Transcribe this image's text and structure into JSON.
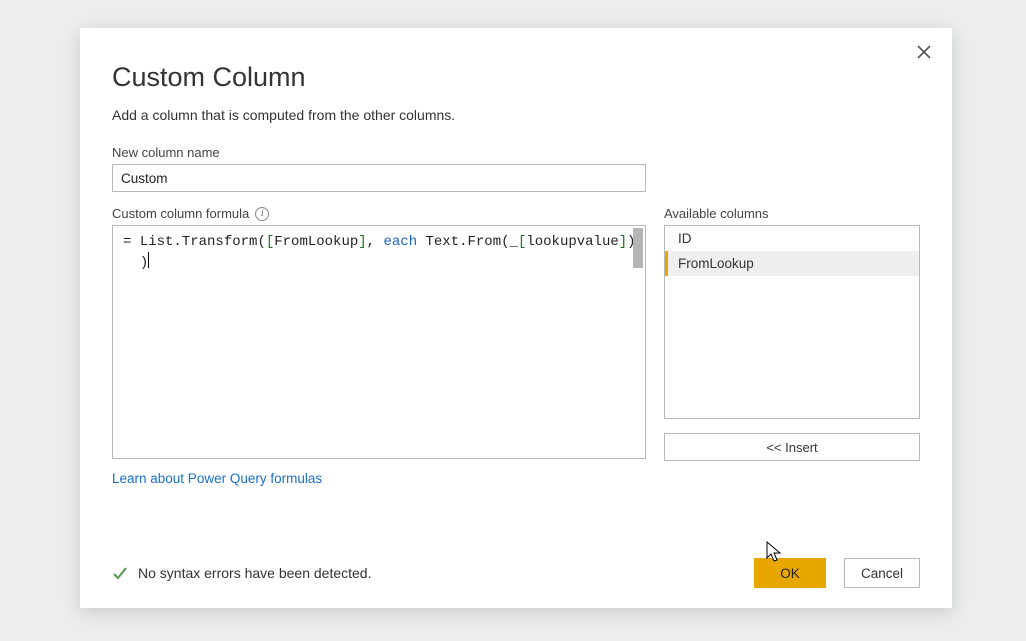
{
  "dialog": {
    "title": "Custom Column",
    "subtitle": "Add a column that is computed from the other columns.",
    "new_column_label": "New column name",
    "new_column_value": "Custom",
    "formula_label": "Custom column formula",
    "formula": {
      "line1_prefix": "= ",
      "fn1": "List.Transform",
      "open1": "(",
      "arg1_open": "[",
      "arg1": "FromLookup",
      "arg1_close": "]",
      "comma1": ", ",
      "each_kw": "each",
      "space1": " ",
      "fn2": "Text.From",
      "open2": "(",
      "underscore": "_",
      "arg2_open": "[",
      "arg2": "lookupvalue",
      "arg2_close": "]",
      "close2": ")",
      "close1": ")",
      "line2_close": ")"
    },
    "available_label": "Available columns",
    "available_columns": [
      "ID",
      "FromLookup"
    ],
    "selected_column_index": 1,
    "insert_label": "<< Insert",
    "learn_link": "Learn about Power Query formulas",
    "status_text": "No syntax errors have been detected.",
    "ok_label": "OK",
    "cancel_label": "Cancel"
  }
}
